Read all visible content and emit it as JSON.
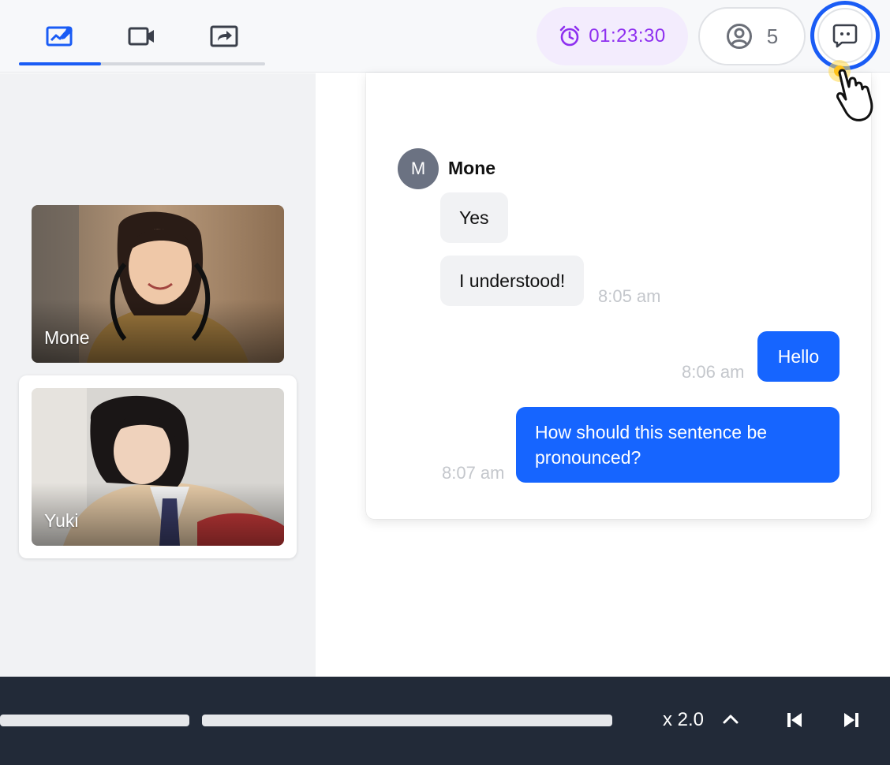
{
  "header": {
    "tabs": [
      {
        "icon": "whiteboard-chart-icon",
        "active": true
      },
      {
        "icon": "video-camera-icon",
        "active": false
      },
      {
        "icon": "share-screen-icon",
        "active": false
      }
    ],
    "timer": "01:23:30",
    "participants_count": "5",
    "chat_button_icon": "chat-bubble-icon"
  },
  "videos": [
    {
      "name": "Mone"
    },
    {
      "name": "Yuki"
    }
  ],
  "chat": {
    "sender_initial": "M",
    "sender_name": "Mone",
    "messages": [
      {
        "text": "Yes",
        "direction": "in"
      },
      {
        "text": "I understood!",
        "direction": "in",
        "time": "8:05 am"
      },
      {
        "text": "Hello",
        "direction": "out",
        "time": "8:06 am"
      },
      {
        "text": "How should this sentence be pronounced?",
        "direction": "out",
        "time": "8:07 am"
      }
    ]
  },
  "player": {
    "speed": "x 2.0"
  },
  "colors": {
    "accent": "#1a5cf5",
    "timer": "#8e2ff0",
    "bottom_bar": "#222a38"
  }
}
